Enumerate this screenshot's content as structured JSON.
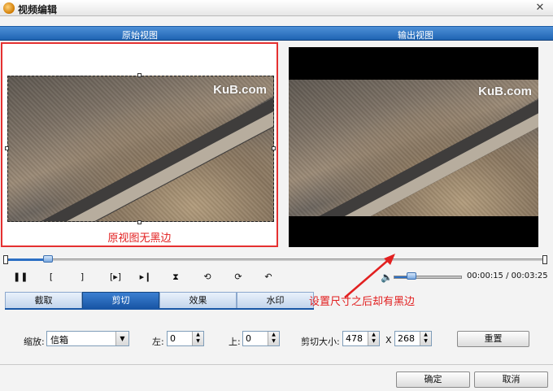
{
  "window": {
    "title": "视频编辑",
    "close_glyph": "✕"
  },
  "views": {
    "original_label": "原始视图",
    "output_label": "输出视图"
  },
  "preview": {
    "watermark": "KuB.com",
    "left_caption": "原视图无黑边"
  },
  "annotation": {
    "text": "设置尺寸之后却有黑边"
  },
  "timeline": {
    "progress": 0.08
  },
  "controls": {
    "pause": "❚❚",
    "mark_in": "[",
    "mark_out": "]",
    "step_frame": "[▸]",
    "to_end": "▸❙",
    "split": "⧗",
    "rotate_left": "⟲",
    "rotate_right": "⟳",
    "undo": "↶"
  },
  "volume": {
    "icon": "speaker-icon",
    "level": 0.26
  },
  "time": {
    "current": "00:00:15",
    "separator": "/",
    "total": "00:03:25",
    "text": "00:00:15 / 00:03:25"
  },
  "tabs": [
    {
      "label": "截取",
      "active": false
    },
    {
      "label": "剪切",
      "active": true
    },
    {
      "label": "效果",
      "active": false
    },
    {
      "label": "水印",
      "active": false
    }
  ],
  "settings": {
    "zoom_label": "缩放:",
    "zoom_value": "信箱",
    "left_label": "左:",
    "left_value": "0",
    "top_label": "上:",
    "top_value": "0",
    "crop_size_label": "剪切大小:",
    "crop_width": "478",
    "crop_x": "X",
    "crop_height": "268",
    "reset_label": "重置"
  },
  "footer": {
    "ok_label": "确定",
    "cancel_label": "取消"
  },
  "colors": {
    "header_blue": "#1f64b3",
    "annotation_red": "#e22020",
    "tab_active": "#1957a6"
  }
}
